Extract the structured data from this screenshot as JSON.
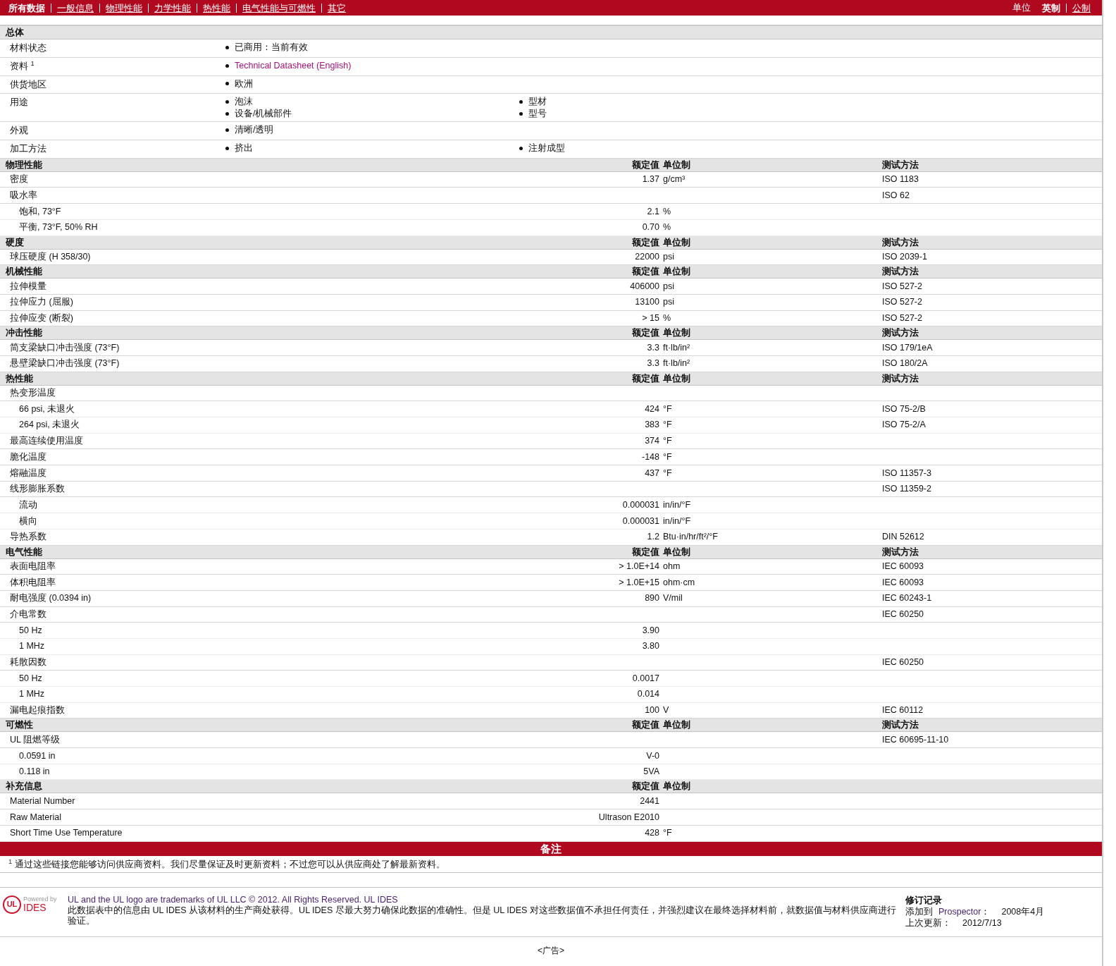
{
  "top_nav": {
    "items": [
      {
        "label": "所有数据",
        "selected": true
      },
      {
        "label": "一般信息",
        "selected": false
      },
      {
        "label": "物理性能",
        "selected": false
      },
      {
        "label": "力学性能",
        "selected": false
      },
      {
        "label": "热性能",
        "selected": false
      },
      {
        "label": "电气性能与可燃性",
        "selected": false
      },
      {
        "label": "其它",
        "selected": false
      }
    ],
    "units_label": "单位",
    "units": [
      {
        "label": "英制",
        "selected": true
      },
      {
        "label": "公制",
        "selected": false
      }
    ]
  },
  "general": {
    "title": "总体",
    "rows": [
      {
        "label": "材料状态",
        "columns": [
          [
            {
              "text": "已商用：当前有效",
              "kind": "text"
            }
          ]
        ]
      },
      {
        "label": "资料 $^{1}$",
        "columns": [
          [
            {
              "text": "Technical Datasheet (English)",
              "kind": "link"
            }
          ]
        ]
      },
      {
        "label": "供货地区",
        "columns": [
          [
            {
              "text": "欧洲",
              "kind": "text"
            }
          ]
        ]
      },
      {
        "label": "用途",
        "columns": [
          [
            {
              "text": "泡沫",
              "kind": "text"
            },
            {
              "text": "设备/机械部件",
              "kind": "text"
            }
          ],
          [
            {
              "text": "型材",
              "kind": "text"
            },
            {
              "text": "型号",
              "kind": "text"
            }
          ]
        ]
      },
      {
        "label": "外观",
        "columns": [
          [
            {
              "text": "清晰/透明",
              "kind": "text"
            }
          ]
        ]
      },
      {
        "label": "加工方法",
        "columns": [
          [
            {
              "text": "挤出",
              "kind": "text"
            }
          ],
          [
            {
              "text": "注射成型",
              "kind": "text"
            }
          ]
        ]
      }
    ]
  },
  "sections": [
    {
      "title": "物理性能",
      "headers": {
        "value": "额定值",
        "unit": "单位制",
        "method": "测试方法"
      },
      "rows": [
        {
          "label": "密度",
          "value": "1.37",
          "unit": "g/cm³",
          "method": "ISO 1183"
        },
        {
          "label": "吸水率",
          "method": "ISO 62",
          "children": [
            {
              "label": "饱和, 73°F",
              "value": "2.1",
              "unit": "%"
            },
            {
              "label": "平衡, 73°F, 50% RH",
              "value": "0.70",
              "unit": "%"
            }
          ]
        }
      ]
    },
    {
      "title": "硬度",
      "headers": {
        "value": "额定值",
        "unit": "单位制",
        "method": "测试方法"
      },
      "rows": [
        {
          "label": "球压硬度 (H 358/30)",
          "value": "22000",
          "unit": "psi",
          "method": "ISO 2039-1"
        }
      ]
    },
    {
      "title": "机械性能",
      "headers": {
        "value": "额定值",
        "unit": "单位制",
        "method": "测试方法"
      },
      "rows": [
        {
          "label": "拉伸模量",
          "value": "406000",
          "unit": "psi",
          "method": "ISO 527-2"
        },
        {
          "label": "拉伸应力 (屈服)",
          "value": "13100",
          "unit": "psi",
          "method": "ISO 527-2"
        },
        {
          "label": "拉伸应变 (断裂)",
          "value": "> 15",
          "unit": "%",
          "method": "ISO 527-2"
        }
      ]
    },
    {
      "title": "冲击性能",
      "headers": {
        "value": "额定值",
        "unit": "单位制",
        "method": "测试方法"
      },
      "rows": [
        {
          "label": "简支梁缺口冲击强度 (73°F)",
          "value": "3.3",
          "unit": "ft·lb/in²",
          "method": "ISO 179/1eA"
        },
        {
          "label": "悬壁梁缺口冲击强度 (73°F)",
          "value": "3.3",
          "unit": "ft·lb/in²",
          "method": "ISO 180/2A"
        }
      ]
    },
    {
      "title": "热性能",
      "headers": {
        "value": "额定值",
        "unit": "单位制",
        "method": "测试方法"
      },
      "rows": [
        {
          "label": "热变形温度",
          "children": [
            {
              "label": "66 psi, 未退火",
              "value": "424",
              "unit": "°F",
              "method": "ISO 75-2/B"
            },
            {
              "label": "264 psi, 未退火",
              "value": "383",
              "unit": "°F",
              "method": "ISO 75-2/A"
            }
          ]
        },
        {
          "label": "最高连续使用温度",
          "value": "374",
          "unit": "°F"
        },
        {
          "label": "脆化温度",
          "value": "-148",
          "unit": "°F"
        },
        {
          "label": "熔融温度",
          "value": "437",
          "unit": "°F",
          "method": "ISO 11357-3"
        },
        {
          "label": "线形膨胀系数",
          "method": "ISO 11359-2",
          "children": [
            {
              "label": "流动",
              "value": "0.000031",
              "unit": "in/in/°F"
            },
            {
              "label": "横向",
              "value": "0.000031",
              "unit": "in/in/°F"
            }
          ]
        },
        {
          "label": "导热系数",
          "value": "1.2",
          "unit": "Btu·in/hr/ft²/°F",
          "method": "DIN 52612"
        }
      ]
    },
    {
      "title": "电气性能",
      "headers": {
        "value": "额定值",
        "unit": "单位制",
        "method": "测试方法"
      },
      "rows": [
        {
          "label": "表面电阻率",
          "value": "> 1.0E+14",
          "unit": "ohm",
          "method": "IEC 60093"
        },
        {
          "label": "体积电阻率",
          "value": "> 1.0E+15",
          "unit": "ohm·cm",
          "method": "IEC 60093"
        },
        {
          "label": "耐电强度 (0.0394 in)",
          "value": "890",
          "unit": "V/mil",
          "method": "IEC 60243-1"
        },
        {
          "label": "介电常数",
          "method": "IEC 60250",
          "children": [
            {
              "label": "50 Hz",
              "value": "3.90"
            },
            {
              "label": "1 MHz",
              "value": "3.80"
            }
          ]
        },
        {
          "label": "耗散因数",
          "method": "IEC 60250",
          "children": [
            {
              "label": "50 Hz",
              "value": "0.0017"
            },
            {
              "label": "1 MHz",
              "value": "0.014"
            }
          ]
        },
        {
          "label": "漏电起痕指数",
          "value": "100",
          "unit": "V",
          "method": "IEC 60112"
        }
      ]
    },
    {
      "title": "可燃性",
      "headers": {
        "value": "额定值",
        "unit": "单位制",
        "method": "测试方法"
      },
      "rows": [
        {
          "label": "UL 阻燃等级",
          "method": "IEC 60695-11-10",
          "children": [
            {
              "label": "0.0591 in",
              "value": "V-0"
            },
            {
              "label": "0.118 in",
              "value": "5VA"
            }
          ]
        }
      ]
    },
    {
      "title": "补充信息",
      "headers": {
        "value": "额定值",
        "unit": "单位制"
      },
      "rows": [
        {
          "label": "Material Number",
          "value": "2441"
        },
        {
          "label": "Raw Material",
          "value": "Ultrason E2010"
        },
        {
          "label": "Short Time Use Temperature",
          "value": "428",
          "unit": "°F"
        }
      ]
    }
  ],
  "notes": {
    "title": "备注",
    "footnote": "$^{1}$ 通过这些链接您能够访问供应商资料。我们尽量保证及时更新资料；不过您可以从供应商处了解最新资料。"
  },
  "footer": {
    "logo": {
      "mark": "UL",
      "powered": "Powered by",
      "brand": "IDES"
    },
    "copyright": "UL and the UL logo are trademarks of UL LLC © 2012. All Rights Reserved. UL IDES",
    "disclaimer": "此数据表中的信息由 UL IDES 从该材料的生产商处获得。UL IDES 尽最大努力确保此数据的准确性。但是 UL IDES 对这些数据值不承担任何责任，并强烈建议在最终选择材料前，就数据值与材料供应商进行验证。",
    "revision": {
      "title": "修订记录",
      "added_label": "添加到",
      "added_link": "Prospector",
      "added_colon": "：",
      "added_date": "2008年4月",
      "updated_label": "上次更新：",
      "updated_date": "2012/7/13"
    },
    "ad": "<广告>"
  }
}
